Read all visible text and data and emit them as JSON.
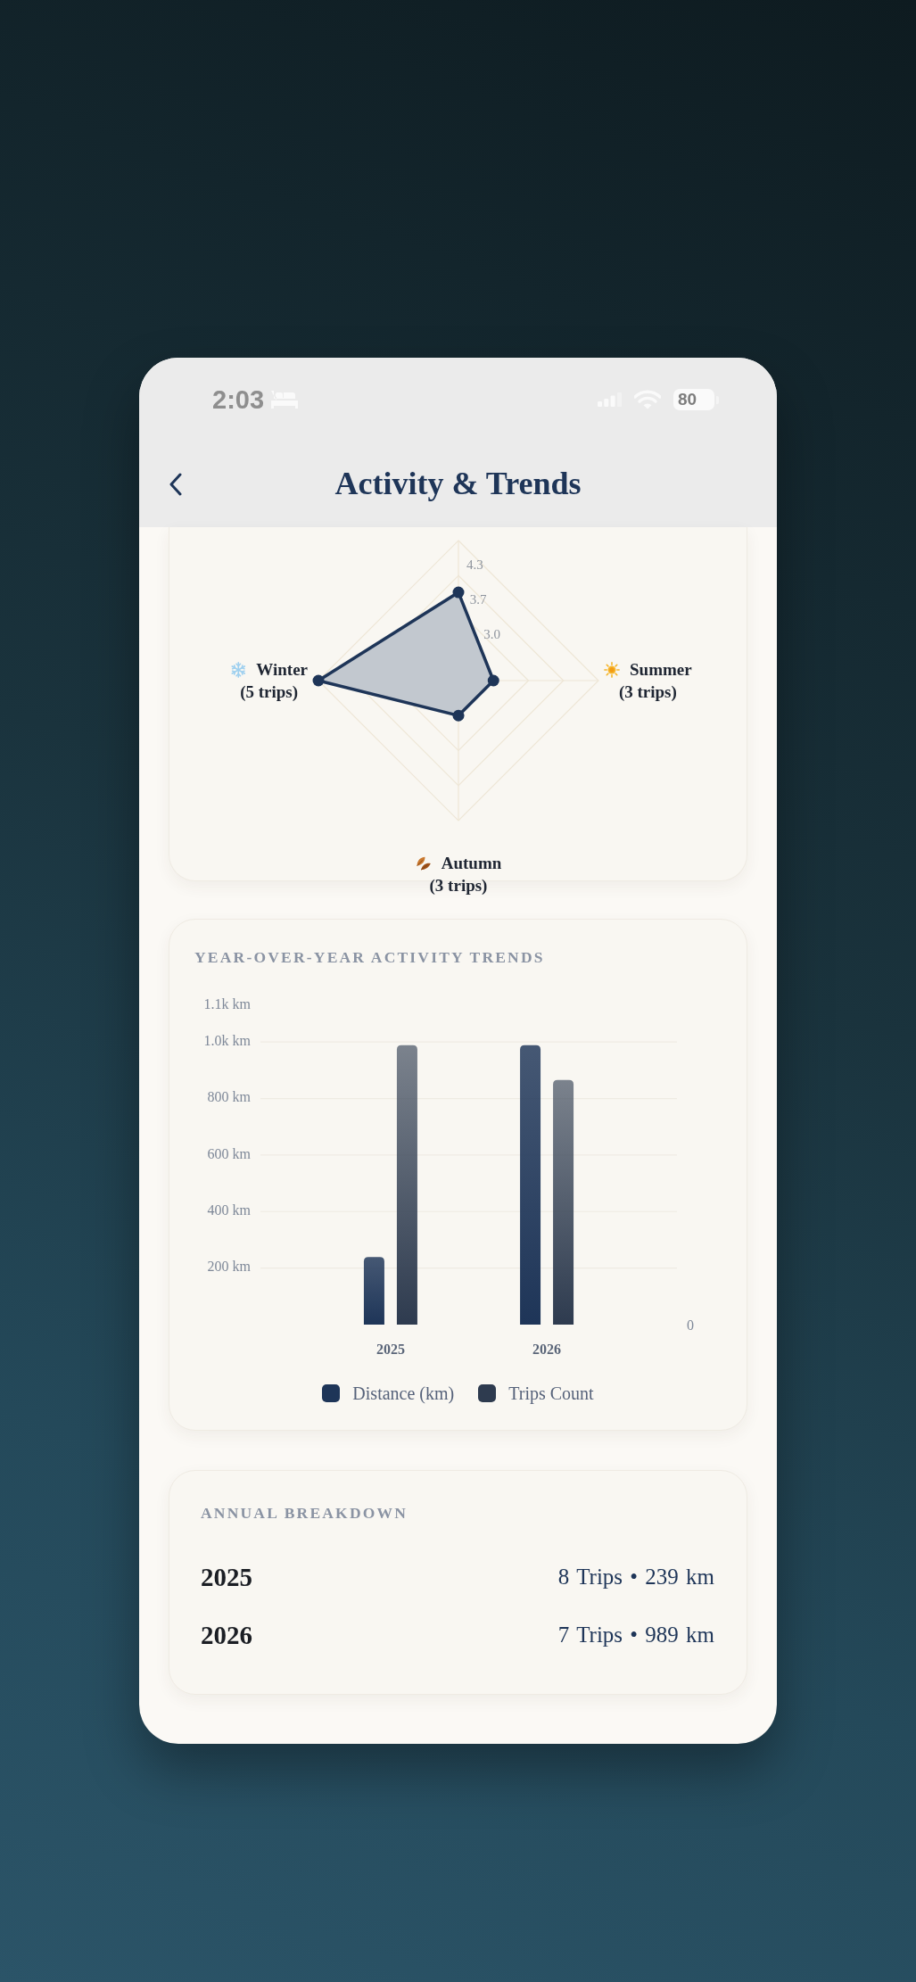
{
  "status_bar": {
    "time": "2:03",
    "battery": "80"
  },
  "header": {
    "title": "Activity & Trends"
  },
  "season_chart": {
    "tick_labels": [
      "4.3",
      "3.7",
      "3.0"
    ],
    "axis_labels": [
      {
        "kind": "sun",
        "label": "Summer",
        "count": "(3 trips)"
      },
      {
        "kind": "leaf",
        "label": "Autumn",
        "count": "(3 trips)"
      },
      {
        "kind": "snow",
        "label": "Winter",
        "count": "(5 trips)"
      }
    ]
  },
  "trends_card": {
    "title": "YEAR-OVER-YEAR ACTIVITY TRENDS",
    "chart_data": {
      "type": "bar",
      "categories": [
        "2025",
        "2026"
      ],
      "series": [
        {
          "name": "Distance (km)",
          "color": "#1e3558",
          "values": [
            239,
            989
          ]
        }
      ],
      "ylim": [
        0,
        1130
      ],
      "yticks": [
        {
          "value": 200,
          "label": "200 km"
        },
        {
          "value": 400,
          "label": "400 km"
        },
        {
          "value": 600,
          "label": "600 km"
        },
        {
          "value": 800,
          "label": "800 km"
        },
        {
          "value": 1000,
          "label": "1.0k km"
        },
        {
          "value": 1130,
          "label": "1.1k km"
        }
      ],
      "grid": true
    },
    "trips_series": {
      "name": "Trips Count",
      "color": "#2e3b4f"
    },
    "right_axis_label": "0"
  },
  "breakdown": {
    "title": "ANNUAL BREAKDOWN",
    "rows": [
      {
        "year": "2025",
        "summary": "8 Trips • 239 km"
      },
      {
        "year": "2026",
        "summary": "7 Trips • 989 km"
      }
    ]
  }
}
